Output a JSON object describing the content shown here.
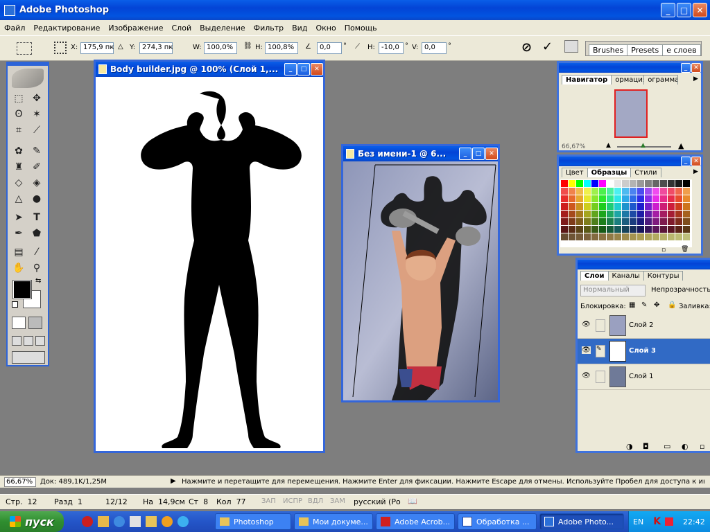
{
  "app": {
    "title": "Adobe Photoshop"
  },
  "menu": [
    "Файл",
    "Редактирование",
    "Изображение",
    "Слой",
    "Выделение",
    "Фильтр",
    "Вид",
    "Окно",
    "Помощь"
  ],
  "options": {
    "x_label": "X:",
    "x_value": "175,9 пк",
    "y_label": "Y:",
    "y_value": "274,3 пк",
    "w_label": "W:",
    "w_value": "100,0%",
    "h_label": "H:",
    "h_value": "100,8%",
    "angle_value": "0,0",
    "angle_unit": "°",
    "hskew_label": "H:",
    "hskew_value": "-10,0",
    "hskew_unit": "°",
    "vskew_label": "V:",
    "vskew_value": "0,0",
    "vskew_unit": "°",
    "cancel_icon": "cancel-icon",
    "commit_icon": "checkmark-icon",
    "well_tabs": [
      "Brushes",
      "Presets",
      "е слоев"
    ]
  },
  "doc1": {
    "title": "Body builder.jpg @ 100% (Слой 1,..."
  },
  "doc2": {
    "title": "Без имени-1 @ 6..."
  },
  "navigator": {
    "tabs": [
      "Навигатор",
      "ормация",
      "ограмма"
    ],
    "zoom": "66,67%"
  },
  "swatches_panel": {
    "tabs": [
      "Цвет",
      "Образцы",
      "Стили"
    ]
  },
  "layers": {
    "tabs": [
      "Слои",
      "Каналы",
      "Контуры"
    ],
    "blend_mode": "Нормальный",
    "opacity_label": "Непрозрачность:",
    "lock_label": "Блокировка:",
    "fill_label": "Заливка:",
    "rows": [
      {
        "name": "Слой 2",
        "selected": false
      },
      {
        "name": "Слой 3",
        "selected": true
      },
      {
        "name": "Слой 1",
        "selected": false
      }
    ]
  },
  "status": {
    "zoom": "66,67%",
    "doc": "Док: 489,1K/1,25M",
    "hint": "Нажмите и перетащите для перемещения. Нажмите Enter для фиксации. Нажмите Escape для отмены. Используйте Пробел для доступа к инстр"
  },
  "wordbar": {
    "page": "Стр.  12",
    "section": "Разд  1",
    "pages": "12/12",
    "at": "На  14,9см",
    "line": "Ст  8",
    "col": "Кол  77",
    "rec": "ЗАП",
    "trk": "ИСПР",
    "ext": "ВДЛ",
    "ovr": "ЗАМ",
    "lang": "русский (Ро"
  },
  "taskbar": {
    "start": "пуск",
    "items": [
      "Photoshop",
      "Мои докуме...",
      "Adobe Acrob...",
      "Обработка ...",
      "Adobe Photo..."
    ],
    "lang": "EN",
    "clock": "22:42"
  },
  "colors": {
    "fg": "#000000",
    "bg": "#ffffff",
    "selection": "#316ac5"
  }
}
